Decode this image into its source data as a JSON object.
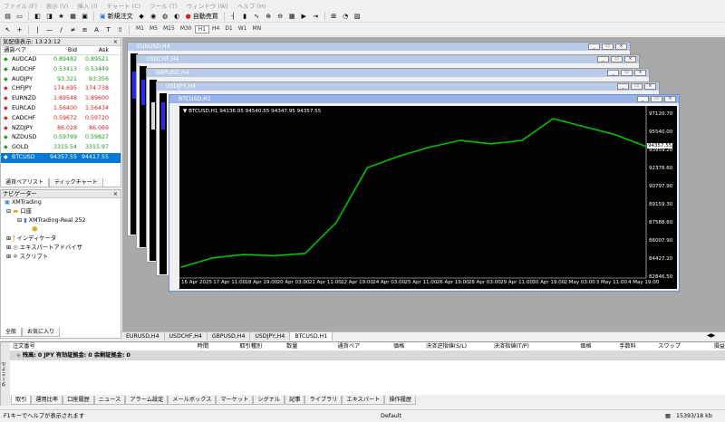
{
  "menu": [
    "ファイル (F)",
    "表示 (V)",
    "挿入 (I)",
    "チャート (C)",
    "ツール (T)",
    "ウィンドウ (W)",
    "ヘルプ (H)"
  ],
  "toolbar": {
    "new_order": "新規注文",
    "auto_trading": "自動売買"
  },
  "timeframes": [
    "M1",
    "M5",
    "M15",
    "M30",
    "H1",
    "H4",
    "D1",
    "W1",
    "MN"
  ],
  "market_watch": {
    "title": "気配値表示: 13:23:12",
    "col_symbol": "通貨ペア",
    "col_bid": "Bid",
    "col_ask": "Ask",
    "rows": [
      {
        "symbol": "AUDCAD",
        "bid": "0.89482",
        "ask": "0.89521",
        "dir": "up"
      },
      {
        "symbol": "AUDCHF",
        "bid": "0.53413",
        "ask": "0.53449",
        "dir": "up"
      },
      {
        "symbol": "AUDJPY",
        "bid": "93.321",
        "ask": "93.356",
        "dir": "up"
      },
      {
        "symbol": "CHFJPY",
        "bid": "174.695",
        "ask": "174.738",
        "dir": "dn"
      },
      {
        "symbol": "EURNZD",
        "bid": "1.89548",
        "ask": "1.89600",
        "dir": "dn"
      },
      {
        "symbol": "EURCAD",
        "bid": "1.56400",
        "ask": "1.56434",
        "dir": "dn"
      },
      {
        "symbol": "CADCHF",
        "bid": "0.59672",
        "ask": "0.59720",
        "dir": "dn"
      },
      {
        "symbol": "NZDJPY",
        "bid": "86.028",
        "ask": "86.069",
        "dir": "dn"
      },
      {
        "symbol": "NZDUSD",
        "bid": "0.59799",
        "ask": "0.59827",
        "dir": "up"
      },
      {
        "symbol": "GOLD",
        "bid": "3315.54",
        "ask": "3315.97",
        "dir": "up"
      },
      {
        "symbol": "BTCUSD",
        "bid": "94357.55",
        "ask": "94417.55",
        "dir": "up"
      }
    ],
    "tabs": [
      "通貨ペアリスト",
      "ティックチャート"
    ]
  },
  "navigator": {
    "title": "ナビゲーター",
    "root": "XMTrading",
    "accounts": "口座",
    "account": "XMTrading-Real 252",
    "indicators": "インディケータ",
    "experts": "エキスパートアドバイザ",
    "scripts": "スクリプト",
    "tabs": [
      "全般",
      "お気に入り"
    ]
  },
  "windows": [
    "EURUSD,H4",
    "USDCHF,H4",
    "GBPUSD,H4",
    "USDJPY,H4",
    "BTCUSD,H1"
  ],
  "chart": {
    "info": "BTCUSD,H1  94136.05 94540.55 94347.95 94357.55",
    "price_tag": "94357.55",
    "color": "#00c000"
  },
  "chart_data": {
    "type": "line",
    "title": "",
    "y_ticks": [
      "97120.70",
      "95540.00",
      "93959.20",
      "92378.60",
      "90797.90",
      "89159.30",
      "87588.60",
      "86007.90",
      "84427.20",
      "82846.50"
    ],
    "x_ticks": [
      "16 Apr 2025",
      "17 Apr 11:00",
      "18 Apr 19:00",
      "20 Apr 03:00",
      "21 Apr 11:00",
      "22 Apr 19:00",
      "24 Apr 03:00",
      "25 Apr 11:00",
      "26 Apr 19:00",
      "28 Apr 03:00",
      "29 Apr 11:00",
      "30 Apr 19:00",
      "2 May 03:00",
      "3 May 11:00",
      "4 May 19:00"
    ],
    "ylim": [
      82846.5,
      97120.7
    ],
    "x": [
      "16 Apr 2025",
      "17 Apr 11:00",
      "18 Apr 19:00",
      "20 Apr 03:00",
      "21 Apr 11:00",
      "22 Apr 19:00",
      "24 Apr 03:00",
      "25 Apr 11:00",
      "26 Apr 19:00",
      "28 Apr 03:00",
      "29 Apr 11:00",
      "30 Apr 19:00",
      "2 May 03:00",
      "3 May 11:00",
      "4 May 19:00",
      "5 May 12:00"
    ],
    "values": [
      83800,
      84600,
      84900,
      84800,
      85000,
      87700,
      92500,
      93500,
      94300,
      94900,
      94600,
      94900,
      96800,
      96100,
      95400,
      94357
    ]
  },
  "chart_tabs": [
    "EURUSD,H4",
    "USDCHF,H4",
    "GBPUSD,H4",
    "USDJPY,H4",
    "BTCUSD,H1"
  ],
  "terminal": {
    "columns": [
      "注文番号",
      "時間",
      "取引種別",
      "数量",
      "通貨ペア",
      "価格",
      "決済逆指値(S/L)",
      "決済指値(T/P)",
      "価格",
      "手数料",
      "スワップ",
      "損益"
    ],
    "balance": "残高: 0 JPY  有効証拠金: 0  余剰証拠金: 0",
    "tabs": [
      "取引",
      "運用比率",
      "口座履歴",
      "ニュース",
      "アラーム設定",
      "メールボックス",
      "マーケット",
      "シグナル",
      "記事",
      "ライブラリ",
      "エキスパート",
      "操作履歴"
    ],
    "side_label": "ターミナル"
  },
  "status": {
    "help": "F1キーでヘルプが表示されます",
    "profile": "Default",
    "traffic": "15393/18 kb"
  }
}
